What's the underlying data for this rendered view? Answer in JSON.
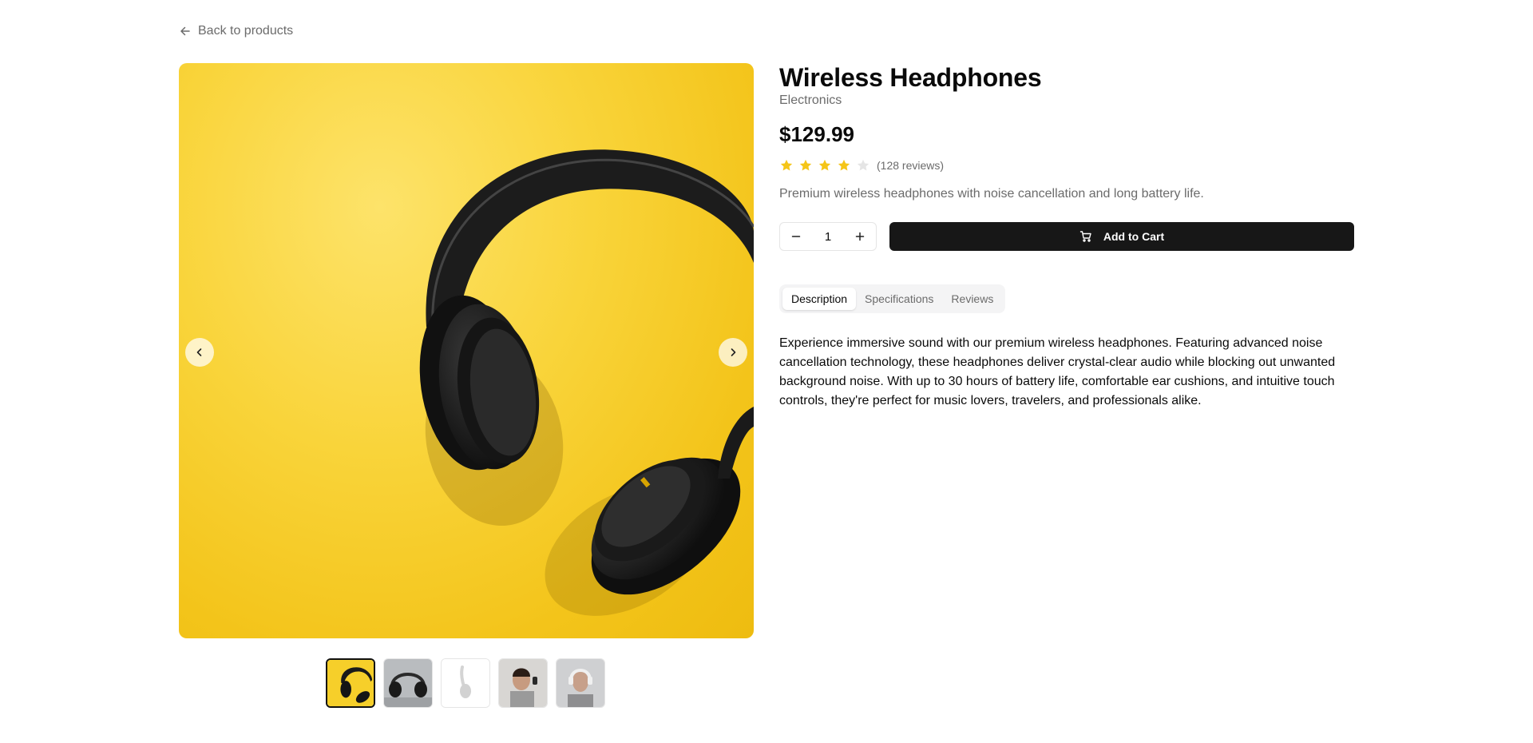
{
  "nav": {
    "back_label": "Back to products"
  },
  "product": {
    "title": "Wireless Headphones",
    "category": "Electronics",
    "price": "$129.99",
    "rating": 4,
    "rating_max": 5,
    "review_count": "(128 reviews)",
    "short_description": "Premium wireless headphones with noise cancellation and long battery life.",
    "long_description": "Experience immersive sound with our premium wireless headphones. Featuring advanced noise cancellation technology, these headphones deliver crystal-clear audio while blocking out unwanted background noise. With up to 30 hours of battery life, comfortable ear cushions, and intuitive touch controls, they're perfect for music lovers, travelers, and professionals alike."
  },
  "cart": {
    "quantity": "1",
    "add_label": "Add to Cart"
  },
  "tabs": [
    {
      "label": "Description",
      "active": true
    },
    {
      "label": "Specifications",
      "active": false
    },
    {
      "label": "Reviews",
      "active": false
    }
  ],
  "gallery": {
    "thumbnail_count": 5,
    "active_index": 0
  },
  "colors": {
    "star": "#f5c518",
    "star_empty": "#e5e5e5",
    "primary_button": "#171717",
    "image_background": "#f9d43a"
  }
}
